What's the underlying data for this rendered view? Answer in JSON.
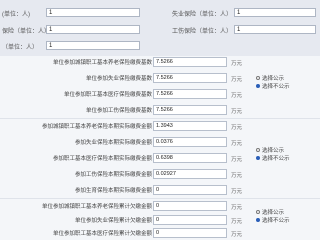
{
  "top": {
    "rows": [
      {
        "label": "(单位：人)",
        "value": "1",
        "label2": "失业保险（单位：人）",
        "value2": "1"
      },
      {
        "label": "保险（单位：人）",
        "value": "1",
        "label2": "工伤保险（单位：人）",
        "value2": "1"
      },
      {
        "label": "（单位：人）",
        "value": "1",
        "label2": "",
        "value2": ""
      }
    ]
  },
  "form": {
    "rows": [
      {
        "label": "单位参加城镇职工基本养老保险缴费基数",
        "value": "7.5266",
        "unit": "万元"
      },
      {
        "label": "单位参加失业保险缴费基数",
        "value": "7.5266",
        "unit": "万元"
      },
      {
        "label": "单位参加职工基本医疗保险缴费基数",
        "value": "7.5266",
        "unit": "万元"
      },
      {
        "label": "单位参加工伤保险缴费基数",
        "value": "7.5266",
        "unit": "万元"
      },
      {
        "label": "参加城镇职工基本养老保险本期实际缴费金额",
        "value": "1.3943",
        "unit": "万元"
      },
      {
        "label": "参加失业保险本期实际缴费金额",
        "value": "0.0376",
        "unit": "万元"
      },
      {
        "label": "参加职工基本医疗保险本期实际缴费金额",
        "value": "0.6398",
        "unit": "万元"
      },
      {
        "label": "参加工伤保险本期实际缴费金额",
        "value": "0.02927",
        "unit": "万元"
      },
      {
        "label": "参加生育保险本期实际缴费金额",
        "value": "0",
        "unit": "万元"
      },
      {
        "label": "单位参加城镇职工基本养老保险累计欠缴金额",
        "value": "0",
        "unit": "万元"
      },
      {
        "label": "单位参加失业保险累计欠缴金额",
        "value": "0",
        "unit": "万元"
      },
      {
        "label": "单位参加职工基本医疗保险累计欠缴金额",
        "value": "0",
        "unit": "万元"
      }
    ],
    "radio_groups": [
      {
        "options": [
          "选择公示",
          "选择不公示"
        ],
        "selected": 1
      },
      {
        "options": [
          "选择公示",
          "选择不公示"
        ],
        "selected": 1
      },
      {
        "options": [
          "选择公示",
          "选择不公示"
        ],
        "selected": 1
      }
    ]
  }
}
